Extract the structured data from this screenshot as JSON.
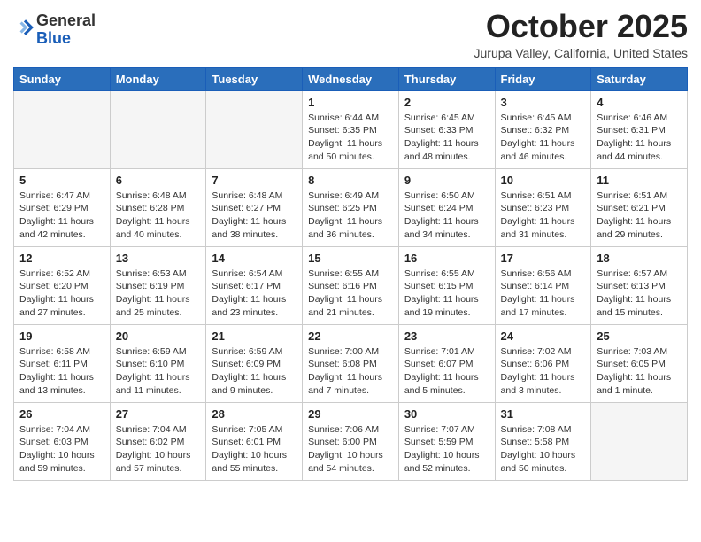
{
  "header": {
    "logo_general": "General",
    "logo_blue": "Blue",
    "month_title": "October 2025",
    "location": "Jurupa Valley, California, United States"
  },
  "days_of_week": [
    "Sunday",
    "Monday",
    "Tuesday",
    "Wednesday",
    "Thursday",
    "Friday",
    "Saturday"
  ],
  "weeks": [
    [
      {
        "day": "",
        "empty": true
      },
      {
        "day": "",
        "empty": true
      },
      {
        "day": "",
        "empty": true
      },
      {
        "day": "1",
        "sunrise": "6:44 AM",
        "sunset": "6:35 PM",
        "daylight": "11 hours and 50 minutes."
      },
      {
        "day": "2",
        "sunrise": "6:45 AM",
        "sunset": "6:33 PM",
        "daylight": "11 hours and 48 minutes."
      },
      {
        "day": "3",
        "sunrise": "6:45 AM",
        "sunset": "6:32 PM",
        "daylight": "11 hours and 46 minutes."
      },
      {
        "day": "4",
        "sunrise": "6:46 AM",
        "sunset": "6:31 PM",
        "daylight": "11 hours and 44 minutes."
      }
    ],
    [
      {
        "day": "5",
        "sunrise": "6:47 AM",
        "sunset": "6:29 PM",
        "daylight": "11 hours and 42 minutes."
      },
      {
        "day": "6",
        "sunrise": "6:48 AM",
        "sunset": "6:28 PM",
        "daylight": "11 hours and 40 minutes."
      },
      {
        "day": "7",
        "sunrise": "6:48 AM",
        "sunset": "6:27 PM",
        "daylight": "11 hours and 38 minutes."
      },
      {
        "day": "8",
        "sunrise": "6:49 AM",
        "sunset": "6:25 PM",
        "daylight": "11 hours and 36 minutes."
      },
      {
        "day": "9",
        "sunrise": "6:50 AM",
        "sunset": "6:24 PM",
        "daylight": "11 hours and 34 minutes."
      },
      {
        "day": "10",
        "sunrise": "6:51 AM",
        "sunset": "6:23 PM",
        "daylight": "11 hours and 31 minutes."
      },
      {
        "day": "11",
        "sunrise": "6:51 AM",
        "sunset": "6:21 PM",
        "daylight": "11 hours and 29 minutes."
      }
    ],
    [
      {
        "day": "12",
        "sunrise": "6:52 AM",
        "sunset": "6:20 PM",
        "daylight": "11 hours and 27 minutes."
      },
      {
        "day": "13",
        "sunrise": "6:53 AM",
        "sunset": "6:19 PM",
        "daylight": "11 hours and 25 minutes."
      },
      {
        "day": "14",
        "sunrise": "6:54 AM",
        "sunset": "6:17 PM",
        "daylight": "11 hours and 23 minutes."
      },
      {
        "day": "15",
        "sunrise": "6:55 AM",
        "sunset": "6:16 PM",
        "daylight": "11 hours and 21 minutes."
      },
      {
        "day": "16",
        "sunrise": "6:55 AM",
        "sunset": "6:15 PM",
        "daylight": "11 hours and 19 minutes."
      },
      {
        "day": "17",
        "sunrise": "6:56 AM",
        "sunset": "6:14 PM",
        "daylight": "11 hours and 17 minutes."
      },
      {
        "day": "18",
        "sunrise": "6:57 AM",
        "sunset": "6:13 PM",
        "daylight": "11 hours and 15 minutes."
      }
    ],
    [
      {
        "day": "19",
        "sunrise": "6:58 AM",
        "sunset": "6:11 PM",
        "daylight": "11 hours and 13 minutes."
      },
      {
        "day": "20",
        "sunrise": "6:59 AM",
        "sunset": "6:10 PM",
        "daylight": "11 hours and 11 minutes."
      },
      {
        "day": "21",
        "sunrise": "6:59 AM",
        "sunset": "6:09 PM",
        "daylight": "11 hours and 9 minutes."
      },
      {
        "day": "22",
        "sunrise": "7:00 AM",
        "sunset": "6:08 PM",
        "daylight": "11 hours and 7 minutes."
      },
      {
        "day": "23",
        "sunrise": "7:01 AM",
        "sunset": "6:07 PM",
        "daylight": "11 hours and 5 minutes."
      },
      {
        "day": "24",
        "sunrise": "7:02 AM",
        "sunset": "6:06 PM",
        "daylight": "11 hours and 3 minutes."
      },
      {
        "day": "25",
        "sunrise": "7:03 AM",
        "sunset": "6:05 PM",
        "daylight": "11 hours and 1 minute."
      }
    ],
    [
      {
        "day": "26",
        "sunrise": "7:04 AM",
        "sunset": "6:03 PM",
        "daylight": "10 hours and 59 minutes."
      },
      {
        "day": "27",
        "sunrise": "7:04 AM",
        "sunset": "6:02 PM",
        "daylight": "10 hours and 57 minutes."
      },
      {
        "day": "28",
        "sunrise": "7:05 AM",
        "sunset": "6:01 PM",
        "daylight": "10 hours and 55 minutes."
      },
      {
        "day": "29",
        "sunrise": "7:06 AM",
        "sunset": "6:00 PM",
        "daylight": "10 hours and 54 minutes."
      },
      {
        "day": "30",
        "sunrise": "7:07 AM",
        "sunset": "5:59 PM",
        "daylight": "10 hours and 52 minutes."
      },
      {
        "day": "31",
        "sunrise": "7:08 AM",
        "sunset": "5:58 PM",
        "daylight": "10 hours and 50 minutes."
      },
      {
        "day": "",
        "empty": true
      }
    ]
  ]
}
